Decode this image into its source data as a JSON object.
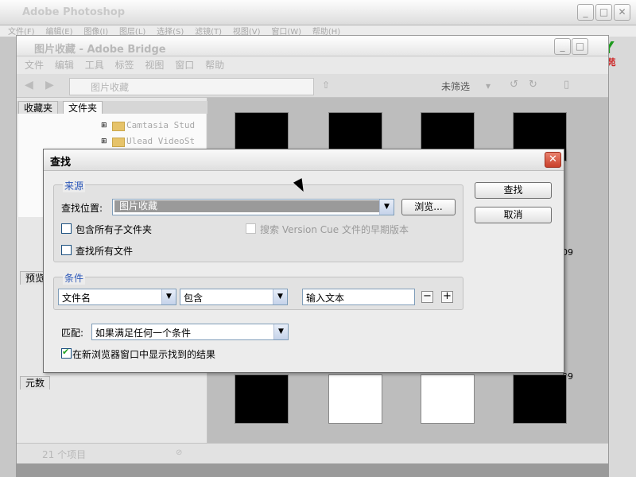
{
  "photoshop": {
    "title": "Adobe Photoshop",
    "menu": [
      "文件(F)",
      "编辑(E)",
      "图像(I)",
      "图层(L)",
      "选择(S)",
      "滤镜(T)",
      "视图(V)",
      "窗口(W)",
      "帮助(H)"
    ]
  },
  "logo": {
    "mark": "YY",
    "text": "育碟苑"
  },
  "bridge": {
    "title": "图片收藏 - Adobe Bridge",
    "menu": [
      "文件",
      "编辑",
      "工具",
      "标签",
      "视图",
      "窗口",
      "帮助"
    ],
    "path": "图片收藏",
    "filter_label": "未筛选",
    "tabs": {
      "favorites": "收藏夹",
      "folders": "文件夹",
      "preview": "预览",
      "metadata": "元数"
    },
    "tree": [
      "Camtasia Stud",
      "Ulead VideoSt"
    ],
    "status": "21 个项目",
    "partial_labels": [
      "09",
      "09"
    ]
  },
  "dialog": {
    "title": "查找",
    "source": {
      "group_title": "来源",
      "location_label": "查找位置:",
      "location_value": "图片收藏",
      "browse_label": "浏览...",
      "include_subfolders": "包含所有子文件夹",
      "find_all_files": "查找所有文件",
      "search_version_cue": "搜索 Version Cue 文件的早期版本"
    },
    "criteria": {
      "group_title": "条件",
      "field": "文件名",
      "operator": "包含",
      "text": "输入文本",
      "remove": "−",
      "add": "+"
    },
    "match_label": "匹配:",
    "match_value": "如果满足任何一个条件",
    "show_results": "在新浏览器窗口中显示找到的结果",
    "find_button": "查找",
    "cancel_button": "取消"
  }
}
